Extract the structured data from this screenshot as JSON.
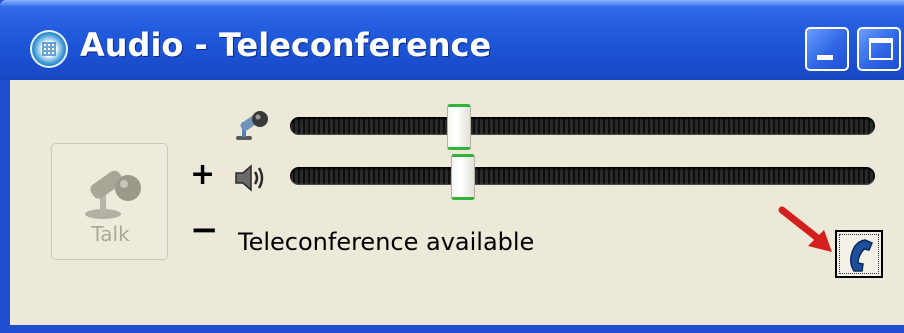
{
  "window": {
    "title": "Audio - Teleconference",
    "app_icon": "teleconference-app-icon",
    "title_buttons": [
      "minimize-icon",
      "maximize-icon"
    ]
  },
  "talk_button": {
    "label": "Talk",
    "icon": "microphone-icon",
    "enabled": false
  },
  "volume": {
    "plus_label": "+",
    "minus_label": "−",
    "microphone": {
      "icon": "microphone-icon",
      "level": 0.29
    },
    "speaker": {
      "icon": "speaker-icon",
      "level": 0.3
    }
  },
  "status": {
    "text": "Teleconference available"
  },
  "teleconference_button": {
    "icon": "phone-handset-icon"
  },
  "annotation": {
    "icon": "red-arrow-icon",
    "color": "#d41f1f"
  },
  "colors": {
    "titlebar": "#1d55d8",
    "window_background": "#ece9d8",
    "slider_thumb_accent": "#34b33a"
  }
}
